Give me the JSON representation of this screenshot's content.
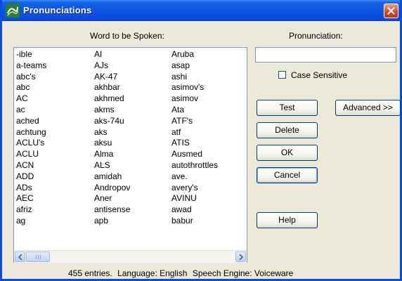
{
  "window": {
    "title": "Pronunciations"
  },
  "colors": {
    "titlebar": "#0a4ce0",
    "close": "#d8451f",
    "dialog_bg": "#ece9d8"
  },
  "headers": {
    "word": "Word to be Spoken:",
    "pronunciation": "Pronunciation:"
  },
  "list": {
    "columns": [
      [
        "-ible",
        "a-teams",
        "abc's",
        "abc",
        "AC",
        "ac",
        "ached",
        "achtung",
        "ACLU's",
        "ACLU",
        "ACN",
        "ADD",
        "ADs",
        "AEC",
        "afriz",
        "ag"
      ],
      [
        "AI",
        "AJs",
        "AK-47",
        "akhbar",
        "akhmed",
        "akms",
        "aks-74u",
        "aks",
        "aksu",
        "Alma",
        "ALS",
        "amidah",
        "Andropov",
        "Aner",
        "antisense",
        "apb"
      ],
      [
        "Aruba",
        "asap",
        "ashi",
        "asimov's",
        "asimov",
        "Ata",
        "ATF's",
        "atf",
        "ATIS",
        "Ausmed",
        "autothrottles",
        "ave.",
        "avery's",
        "AVINU",
        "awad",
        "babur"
      ]
    ]
  },
  "pronunciation_input": {
    "value": "",
    "placeholder": ""
  },
  "case_sensitive": {
    "label": "Case Sensitive",
    "checked": false
  },
  "buttons": {
    "test": "Test",
    "advanced": "Advanced >>",
    "delete": "Delete",
    "ok": "OK",
    "cancel": "Cancel",
    "help": "Help"
  },
  "status": {
    "entries": "455 entries.",
    "language": "Language: English",
    "engine": "Speech Engine: Voiceware"
  },
  "icons": {
    "app": "speech-app-icon",
    "close": "close-icon"
  }
}
